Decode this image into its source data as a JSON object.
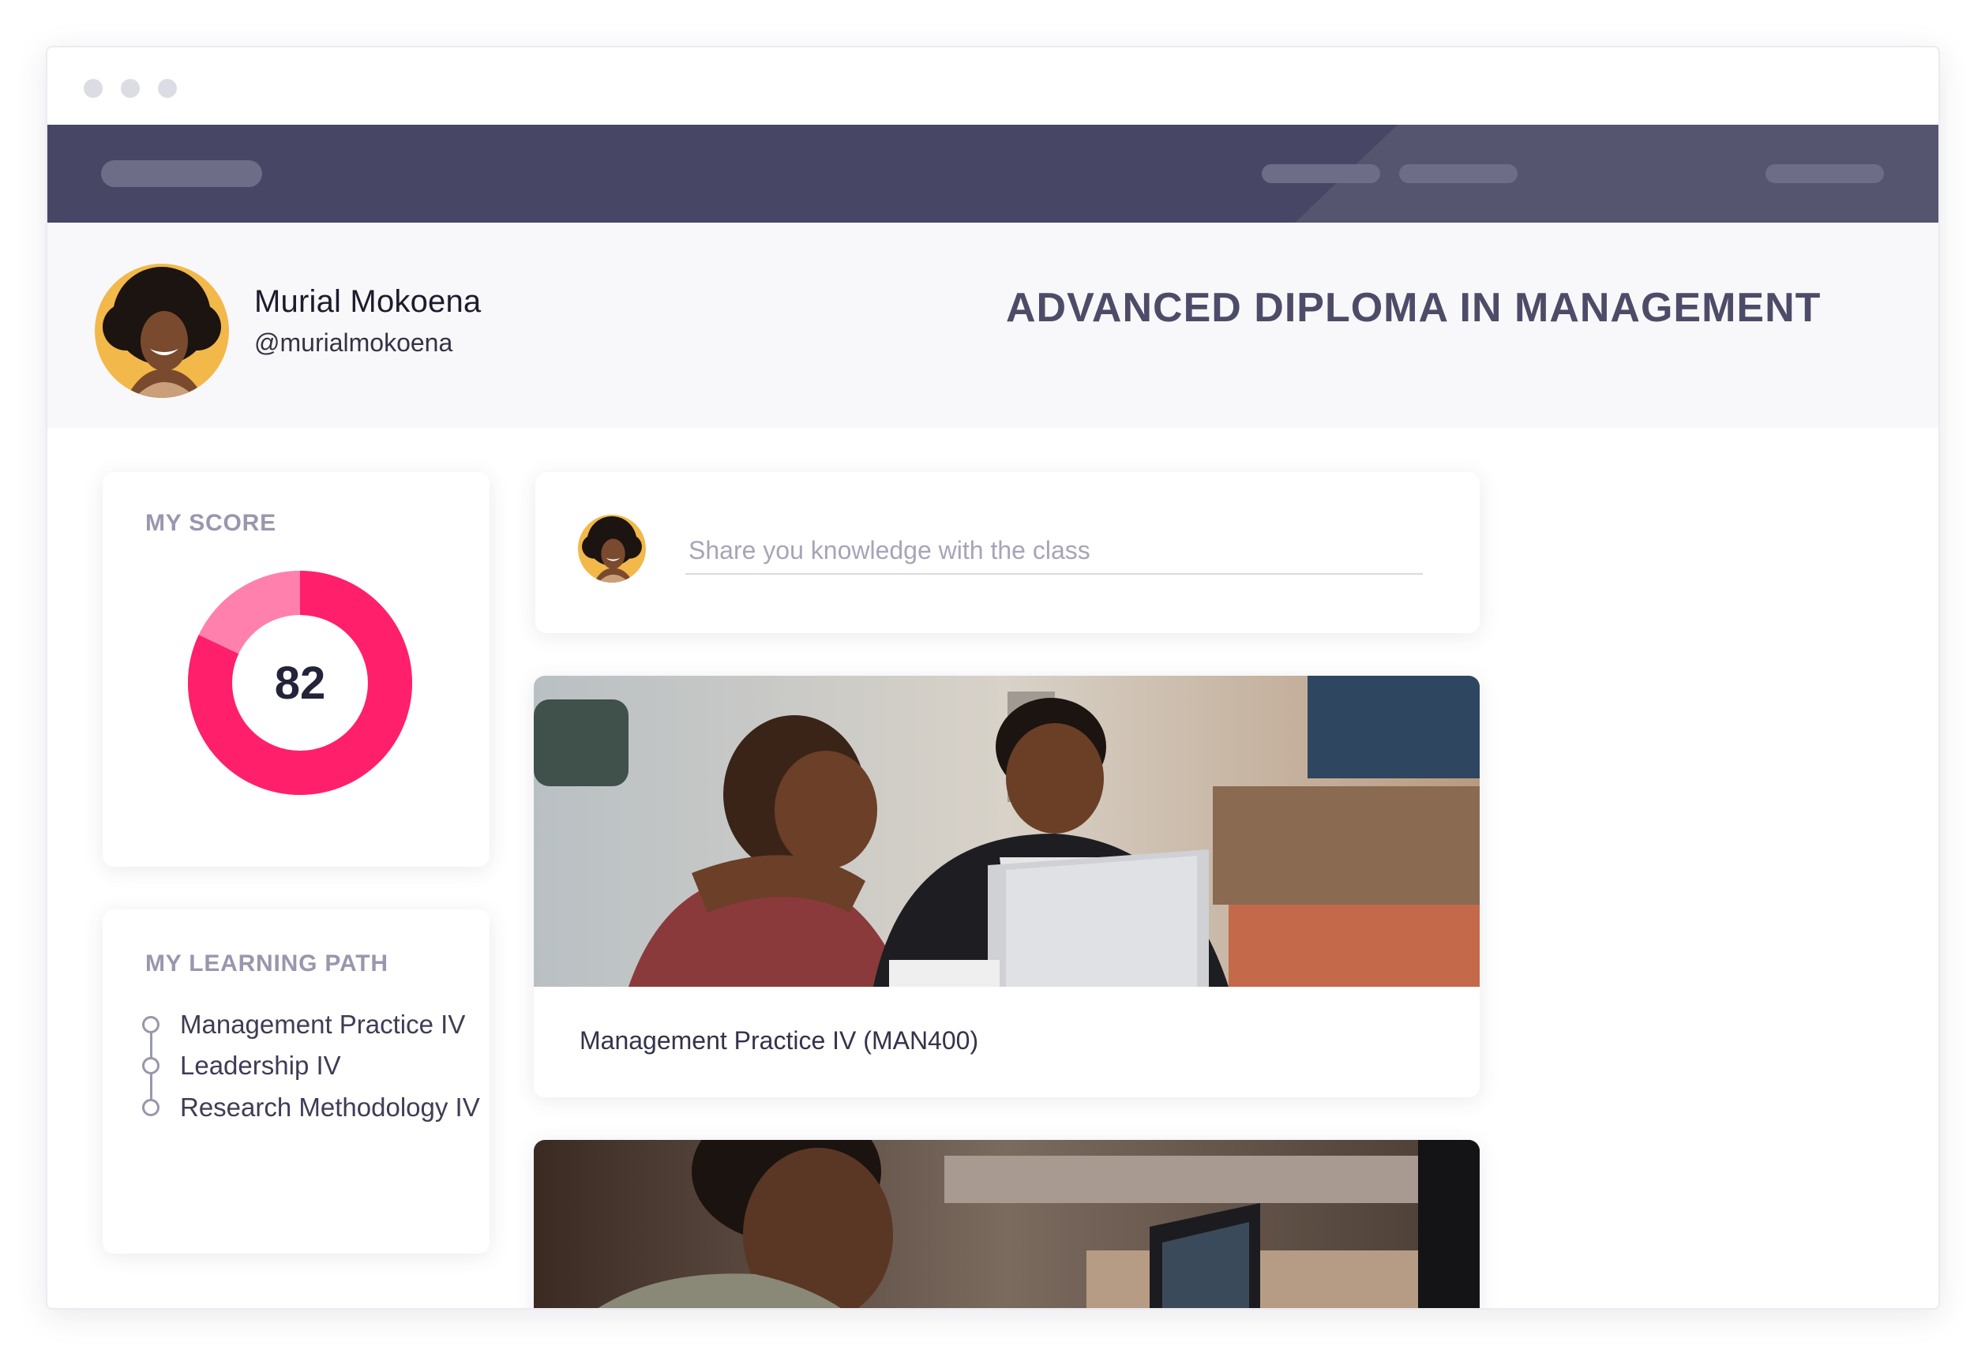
{
  "window": {
    "controls": [
      "window-dot",
      "window-dot",
      "window-dot"
    ]
  },
  "navbar": {
    "placeholders": [
      "logo-placeholder",
      "nav-link-placeholder",
      "nav-link-placeholder",
      "account-placeholder"
    ]
  },
  "profile": {
    "name": "Murial Mokoena",
    "handle": "@murialmokoena",
    "program_title": "ADVANCED DIPLOMA IN MANAGEMENT"
  },
  "score": {
    "heading": "MY SCORE",
    "value": "82",
    "percent": 82,
    "colors": {
      "primary": "#ff1f6b",
      "secondary": "#ff80ad"
    }
  },
  "learning_path": {
    "heading": "MY LEARNING PATH",
    "items": [
      {
        "label": "Management Practice IV"
      },
      {
        "label": "Leadership IV"
      },
      {
        "label": "Research Methodology IV"
      }
    ]
  },
  "composer": {
    "placeholder": "Share you knowledge with the class"
  },
  "courses": [
    {
      "title": "Management Practice IV (MAN400)",
      "image": "students-with-laptop-photo"
    },
    {
      "title": "",
      "image": "student-at-laptop-photo"
    }
  ],
  "colors": {
    "navbar": "#474664",
    "heading": "#4d4c68",
    "muted": "#9897ad",
    "accent": "#ff1f6b"
  }
}
